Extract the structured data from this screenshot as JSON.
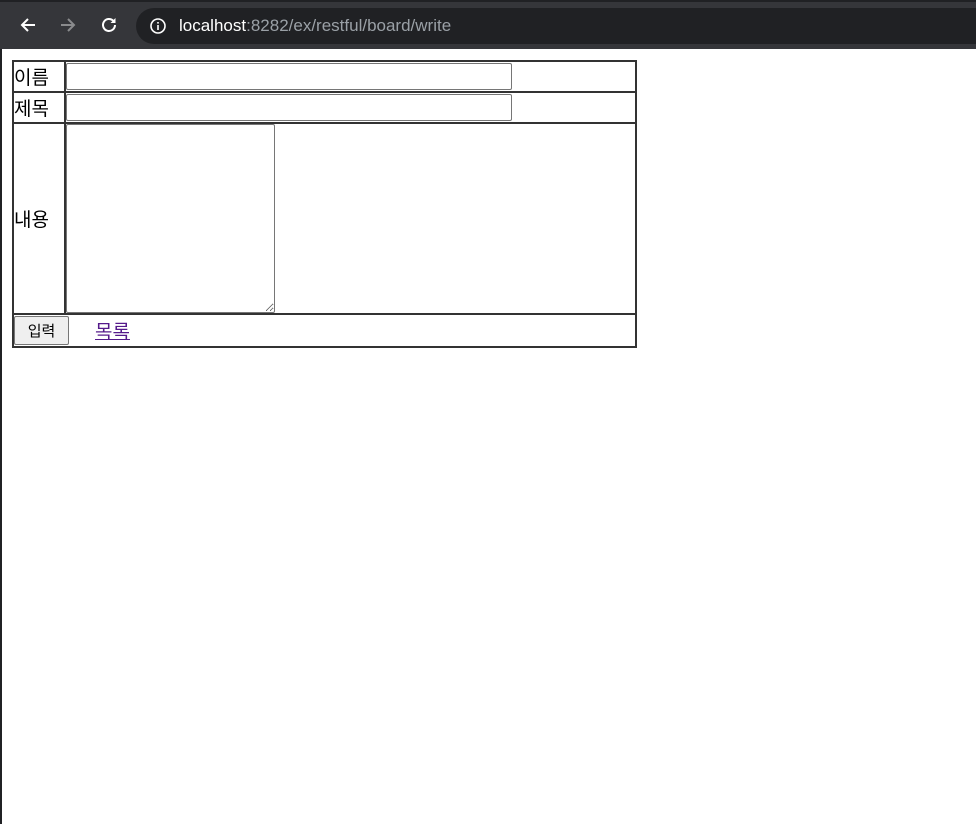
{
  "browser": {
    "url_host": "localhost",
    "url_rest": ":8282/ex/restful/board/write",
    "back_icon": "arrow-left-icon",
    "forward_icon": "arrow-right-icon",
    "reload_icon": "reload-icon",
    "info_icon": "info-icon"
  },
  "form": {
    "name_label": "이름",
    "name_value": "",
    "title_label": "제목",
    "title_value": "",
    "content_label": "내용",
    "content_value": "",
    "submit_label": "입력",
    "list_link": "목록"
  },
  "colors": {
    "chrome_bg": "#35363a",
    "omnibox_bg": "#202124",
    "visited_link": "#551a8b",
    "table_border": "#333333"
  }
}
